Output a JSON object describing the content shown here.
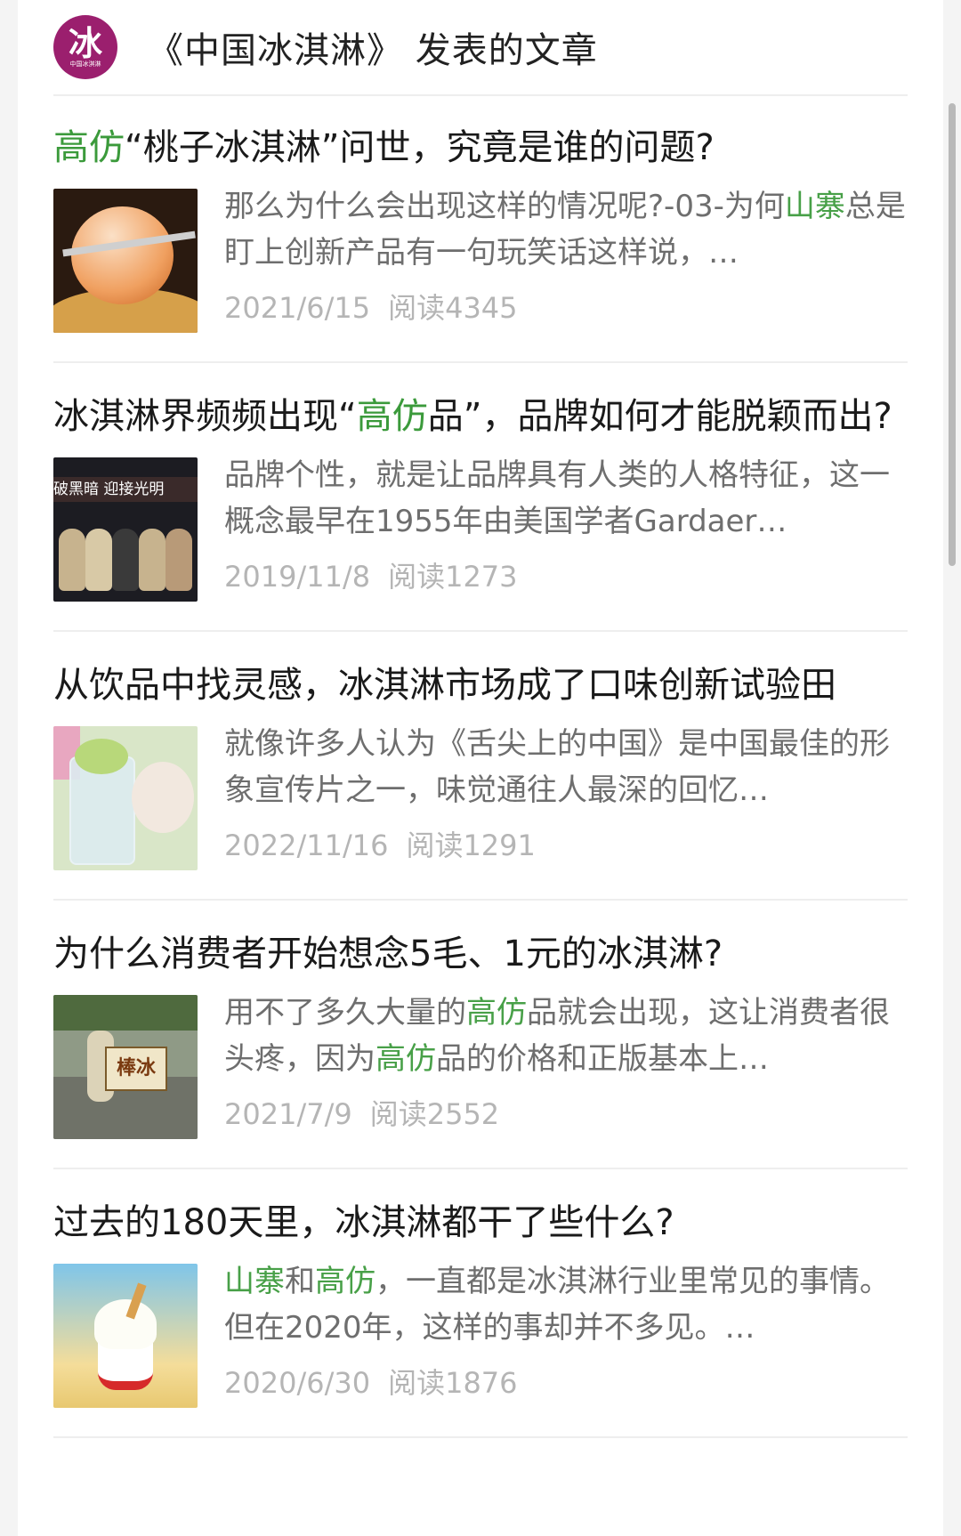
{
  "header": {
    "avatar_char": "冰",
    "avatar_sub": "中国冰淇淋",
    "title": "《中国冰淇淋》 发表的文章"
  },
  "articles": [
    {
      "title_parts": [
        {
          "text": "高仿",
          "hl": true
        },
        {
          "text": "“桃子冰淇淋”问世，究竟是谁的问题?",
          "hl": false
        }
      ],
      "summary_parts": [
        {
          "text": "那么为什么会出现这样的情况呢?-03-为何",
          "hl": false
        },
        {
          "text": "山寨",
          "hl": true
        },
        {
          "text": "总是盯上创新产品有一句玩笑话这样说，…",
          "hl": false
        }
      ],
      "date": "2021/6/15",
      "reads": "阅读4345",
      "thumb": "peach-icecream-image"
    },
    {
      "title_parts": [
        {
          "text": "冰淇淋界频频出现“",
          "hl": false
        },
        {
          "text": "高仿",
          "hl": true
        },
        {
          "text": "品”，品牌如何才能脱颖而出?",
          "hl": false
        }
      ],
      "summary_parts": [
        {
          "text": "品牌个性，就是让品牌具有人类的人格特征，这一概念最早在1955年由美国学者Gardaer…",
          "hl": false
        }
      ],
      "date": "2019/11/8",
      "reads": "阅读1273",
      "thumb": "bear-figures-image",
      "thumb_text": "破黑暗 迎接光明"
    },
    {
      "title_parts": [
        {
          "text": "从饮品中找灵感，冰淇淋市场成了口味创新试验田",
          "hl": false
        }
      ],
      "summary_parts": [
        {
          "text": "就像许多人认为《舌尖上的中国》是中国最佳的形象宣传片之一，味觉通往人最深的回忆…",
          "hl": false
        }
      ],
      "date": "2022/11/16",
      "reads": "阅读1291",
      "thumb": "grape-drink-image"
    },
    {
      "title_parts": [
        {
          "text": "为什么消费者开始想念5毛、1元的冰淇淋?",
          "hl": false
        }
      ],
      "summary_parts": [
        {
          "text": "用不了多久大量的",
          "hl": false
        },
        {
          "text": "高仿",
          "hl": true
        },
        {
          "text": "品就会出现，这让消费者很头疼，因为",
          "hl": false
        },
        {
          "text": "高仿",
          "hl": true
        },
        {
          "text": "品的价格和正版基本上…",
          "hl": false
        }
      ],
      "date": "2021/7/9",
      "reads": "阅读2552",
      "thumb": "popsicle-cart-image",
      "thumb_text": "棒冰"
    },
    {
      "title_parts": [
        {
          "text": "过去的180天里，冰淇淋都干了些什么?",
          "hl": false
        }
      ],
      "summary_parts": [
        {
          "text": "山寨",
          "hl": true
        },
        {
          "text": "和",
          "hl": false
        },
        {
          "text": "高仿",
          "hl": true
        },
        {
          "text": "，一直都是冰淇淋行业里常见的事情。但在2020年，这样的事却并不多见。…",
          "hl": false
        }
      ],
      "date": "2020/6/30",
      "reads": "阅读1876",
      "thumb": "sundae-image"
    }
  ],
  "colors": {
    "highlight": "#3b9a3b",
    "avatar_bg": "#9b1f6e",
    "meta_text": "#b5b5b5"
  }
}
